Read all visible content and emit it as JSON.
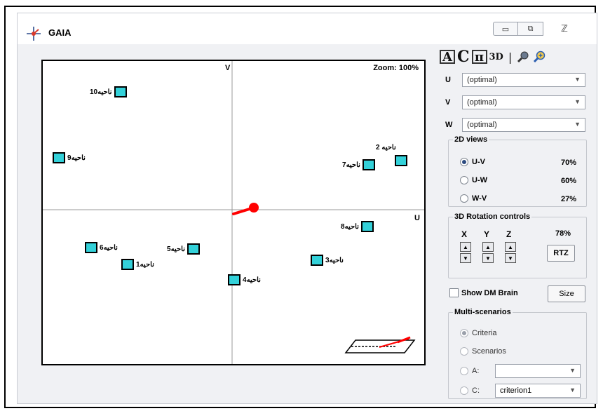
{
  "window": {
    "title": "GAIA",
    "minimize_glyph": "▭",
    "maximize_glyph": "⧉",
    "close_glyph": "ℤ"
  },
  "plot": {
    "zoom_label": "Zoom: 100%",
    "v_axis_label": "V",
    "u_axis_label": "U",
    "points": [
      {
        "label": "ناحیه10"
      },
      {
        "label": "ناحیه9"
      },
      {
        "label": "ناحیه 2"
      },
      {
        "label": "ناحیه7"
      },
      {
        "label": "ناحیه8"
      },
      {
        "label": "ناحیه6"
      },
      {
        "label": "ناحیه5"
      },
      {
        "label": "ناحیه1"
      },
      {
        "label": "ناحیه3"
      },
      {
        "label": "ناحیه4"
      }
    ],
    "marker_color": "#33d1d9",
    "decision_stick_color": "#ff0000"
  },
  "toolbar": {
    "a_label": "A",
    "c_label": "C",
    "pi_label": "π",
    "three_d_label": "3D",
    "sep": "|",
    "zoom_out_icon": "magnifier-icon",
    "zoom_in_icon": "magnifier-plus-icon"
  },
  "axes": {
    "u_key": "U",
    "u_value": "(optimal)",
    "v_key": "V",
    "v_value": "(optimal)",
    "w_key": "W",
    "w_value": "(optimal)"
  },
  "views_2d": {
    "legend": "2D views",
    "options": [
      {
        "label": "U-V",
        "pct": "70%",
        "selected": true
      },
      {
        "label": "U-W",
        "pct": "60%",
        "selected": false
      },
      {
        "label": "W-V",
        "pct": "27%",
        "selected": false
      }
    ]
  },
  "rotation": {
    "legend": "3D Rotation controls",
    "x": "X",
    "y": "Y",
    "z": "Z",
    "pct": "78%",
    "rtz_label": "RTZ",
    "up_glyph": "▲",
    "down_glyph": "▼"
  },
  "dm_brain": {
    "label": "Show DM Brain",
    "checked": false,
    "size_label": "Size"
  },
  "multi": {
    "legend": "Multi-scenarios",
    "criteria_label": "Criteria",
    "scenarios_label": "Scenarios",
    "a_label": "A:",
    "a_value": "",
    "c_label": "C:",
    "c_value": "criterion1"
  }
}
